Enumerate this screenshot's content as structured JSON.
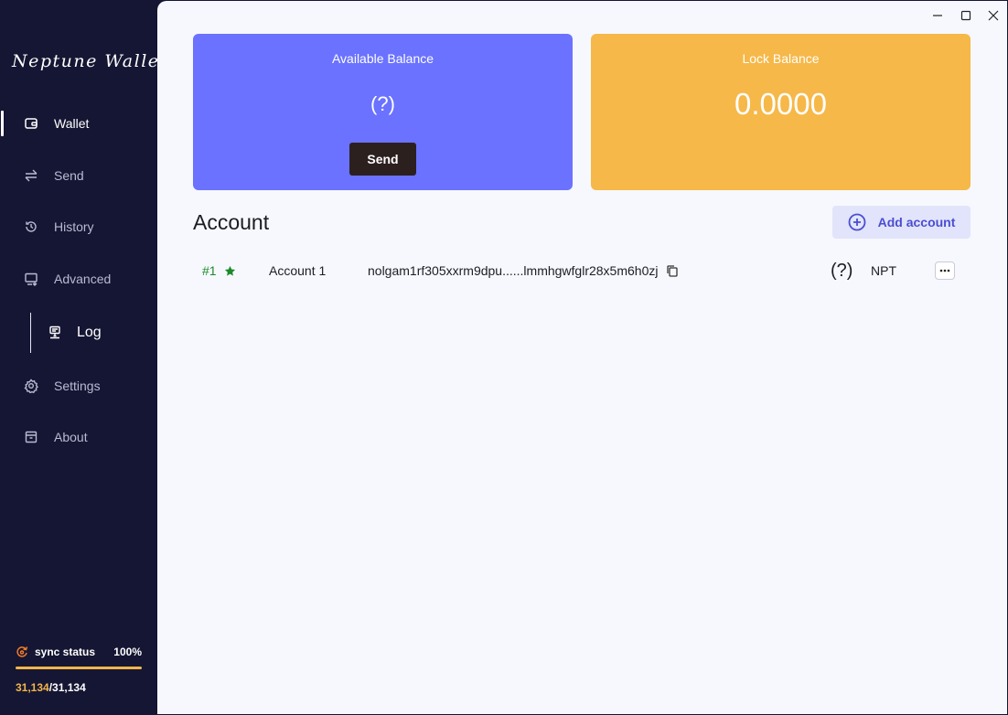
{
  "app": {
    "logo_text": "Neptune Wallet"
  },
  "sidebar": {
    "items": [
      {
        "label": "Wallet",
        "icon": "wallet-icon"
      },
      {
        "label": "Send",
        "icon": "transfer-arrows-icon"
      },
      {
        "label": "History",
        "icon": "history-icon"
      },
      {
        "label": "Advanced",
        "icon": "monitor-icon"
      },
      {
        "label": "Log",
        "icon": "server-log-icon"
      },
      {
        "label": "Settings",
        "icon": "gear-icon"
      },
      {
        "label": "About",
        "icon": "archive-box-icon"
      }
    ],
    "sync": {
      "label": "sync status",
      "percent_text": "100%",
      "progress": 1.0,
      "current": "31,134",
      "separator": "/",
      "total": "31,134"
    }
  },
  "cards": {
    "available": {
      "title": "Available Balance",
      "value": "(?)",
      "button": "Send"
    },
    "lock": {
      "title": "Lock Balance",
      "value": "0.0000"
    }
  },
  "accounts": {
    "title": "Account",
    "add_button": "Add account",
    "rows": [
      {
        "number": "#1",
        "name": "Account 1",
        "address": "nolgam1rf305xxrm9dpu......lmmhgwfglr28x5m6h0zj",
        "balance": "(?)",
        "unit": "NPT"
      }
    ]
  },
  "colors": {
    "sidebar_bg": "#151633",
    "main_bg": "#f6f8fd",
    "available_card": "#6a72ff",
    "lock_card": "#f6b849",
    "send_button": "#2c201f",
    "accent": "#4a4ed0",
    "account_number": "#1c8a2a",
    "sync_accent": "#f5b64a"
  }
}
